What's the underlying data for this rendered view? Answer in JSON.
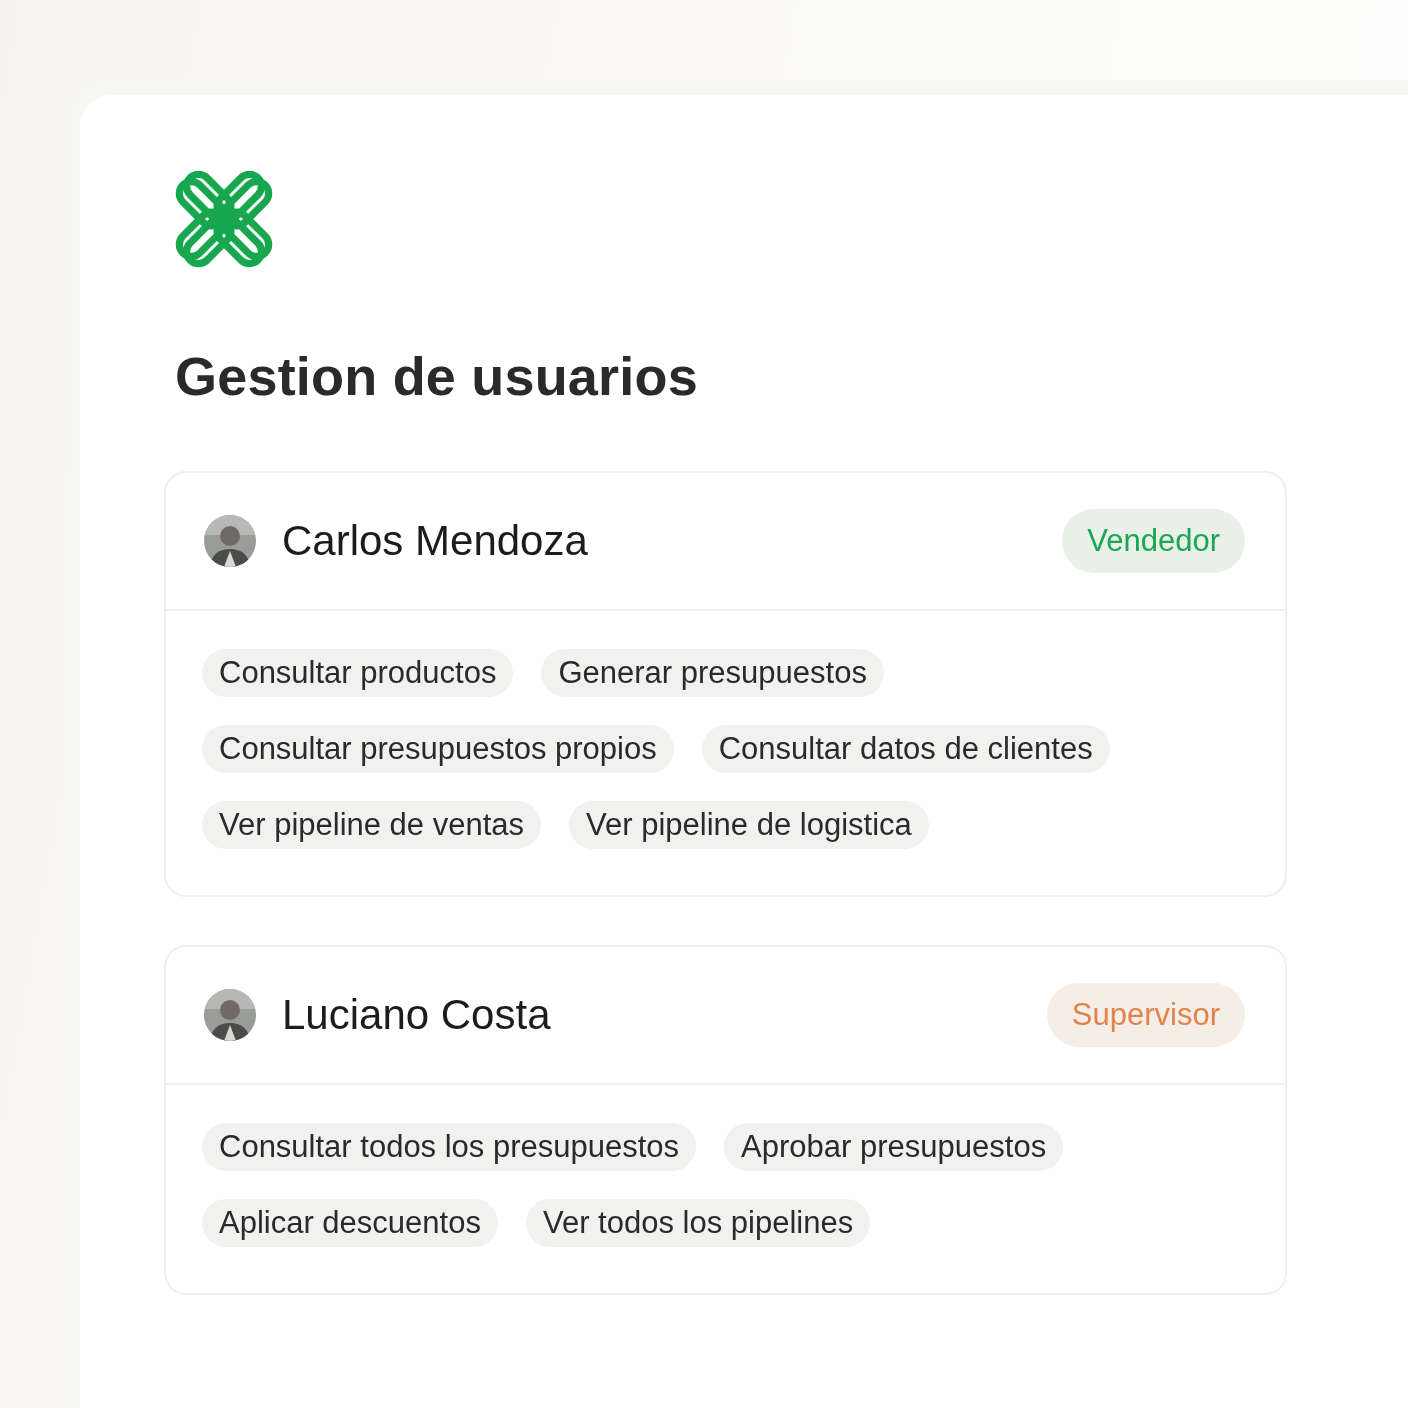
{
  "title": "Gestion de usuarios",
  "users": [
    {
      "name": "Carlos Mendoza",
      "role": {
        "label": "Vendedor",
        "color": "#1aa653"
      },
      "permissions": [
        "Consultar productos",
        "Generar presupuestos",
        "Consultar presupuestos propios",
        "Consultar datos de clientes",
        "Ver pipeline de ventas",
        "Ver pipeline de logistica"
      ]
    },
    {
      "name": "Luciano Costa",
      "role": {
        "label": "Supervisor",
        "color": "#e0834d"
      },
      "permissions": [
        "Consultar todos los presupuestos",
        "Aprobar presupuestos",
        "Aplicar descuentos",
        "Ver todos los pipelines"
      ]
    }
  ]
}
